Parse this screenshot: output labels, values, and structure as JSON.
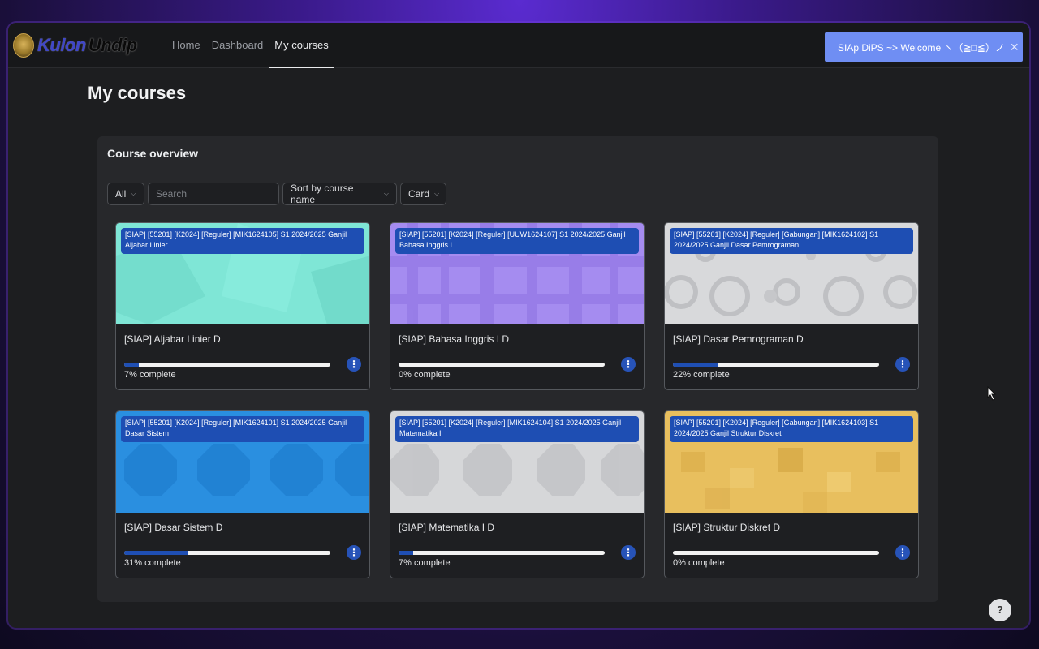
{
  "brand": {
    "part1": "Kulon",
    "part2": "Undip"
  },
  "nav": {
    "items": [
      "Home",
      "Dashboard",
      "My courses"
    ],
    "active_index": 2
  },
  "notification": {
    "text": "SIAp DiPS ~> Welcome ヽ（≧□≦）ノ",
    "close_icon": "close-icon"
  },
  "page": {
    "title": "My courses"
  },
  "overview": {
    "title": "Course overview",
    "filter": "All",
    "search_placeholder": "Search",
    "sort": "Sort by course name",
    "view": "Card"
  },
  "courses": [
    {
      "label": "[SIAP] [55201] [K2024] [Reguler] [MIK1624105] S1 2024/2025 Ganjil Aljabar Linier",
      "name": "[SIAP] Aljabar Linier D",
      "progress": 7,
      "progress_text": "7% complete",
      "color": "#7fe6d6"
    },
    {
      "label": "[SIAP] [55201] [K2024] [Reguler] [UUW1624107] S1 2024/2025 Ganjil Bahasa Inggris I",
      "name": "[SIAP] Bahasa Inggris I D",
      "progress": 0,
      "progress_text": "0% complete",
      "color": "#a58cf0"
    },
    {
      "label": "[SIAP] [55201] [K2024] [Reguler] [Gabungan] [MIK1624102] S1 2024/2025 Ganjil Dasar Pemrograman",
      "name": "[SIAP] Dasar Pemrograman D",
      "progress": 22,
      "progress_text": "22% complete",
      "color": "#d8d9db"
    },
    {
      "label": "[SIAP] [55201] [K2024] [Reguler] [MIK1624101] S1 2024/2025 Ganjil Dasar Sistem",
      "name": "[SIAP] Dasar Sistem D",
      "progress": 31,
      "progress_text": "31% complete",
      "color": "#2a8fe0"
    },
    {
      "label": "[SIAP] [55201] [K2024] [Reguler] [MIK1624104] S1 2024/2025 Ganjil Matematika I",
      "name": "[SIAP] Matematika I D",
      "progress": 7,
      "progress_text": "7% complete",
      "color": "#d6d7d9"
    },
    {
      "label": "[SIAP] [55201] [K2024] [Reguler] [Gabungan] [MIK1624103] S1 2024/2025 Ganjil Struktur Diskret",
      "name": "[SIAP] Struktur Diskret D",
      "progress": 0,
      "progress_text": "0% complete",
      "color": "#e8bf5e"
    }
  ],
  "help": {
    "label": "?"
  }
}
